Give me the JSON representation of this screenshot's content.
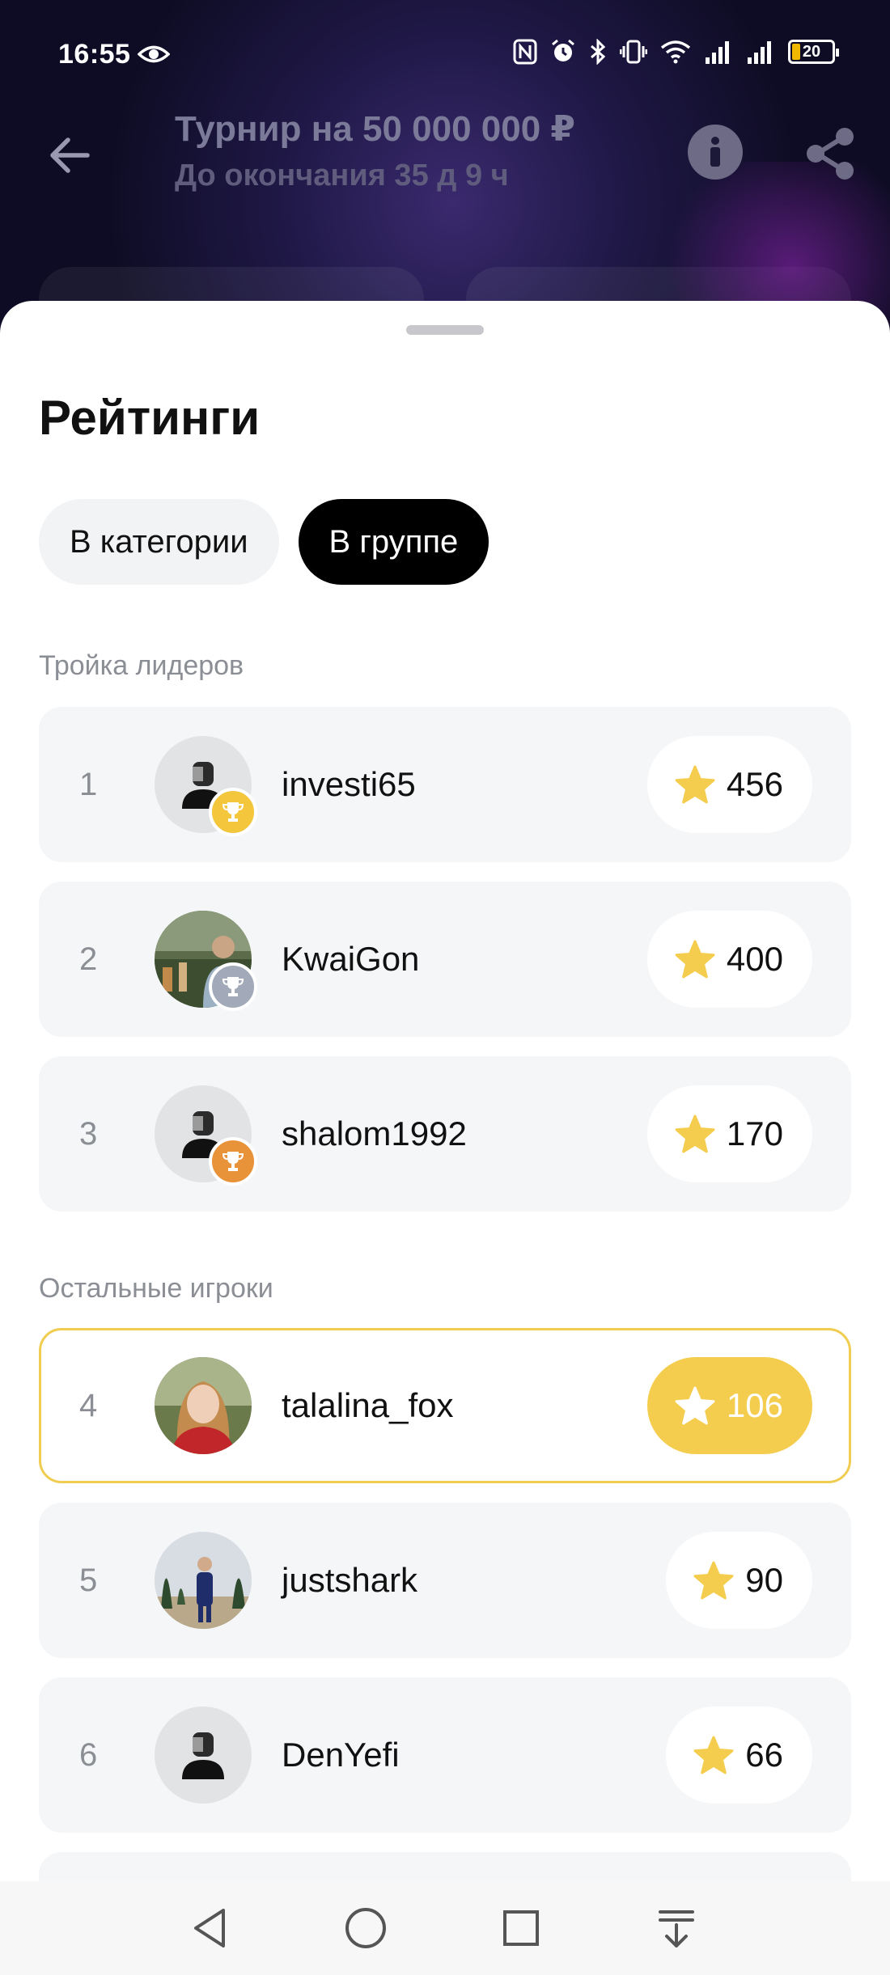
{
  "status_bar": {
    "time": "16:55",
    "battery": "20",
    "icons": [
      "eye-icon",
      "nfc-icon",
      "alarm-icon",
      "bluetooth-icon",
      "vibrate-icon",
      "wifi-icon",
      "signal-icon",
      "signal-icon",
      "battery-icon"
    ]
  },
  "header": {
    "title": "Турнир на 50 000 000 ₽",
    "subtitle": "До окончания 35 д 9 ч",
    "back_icon": "arrow-left-icon",
    "info_icon": "info-icon",
    "share_icon": "share-icon"
  },
  "sheet": {
    "title": "Рейтинги",
    "tabs": [
      {
        "label": "В категории",
        "active": false
      },
      {
        "label": "В группе",
        "active": true
      }
    ],
    "leaders_label": "Тройка лидеров",
    "others_label": "Остальные игроки"
  },
  "leaders": [
    {
      "rank": "1",
      "username": "investi65",
      "score": "456",
      "medal": "gold",
      "avatar": "default"
    },
    {
      "rank": "2",
      "username": "KwaiGon",
      "score": "400",
      "medal": "silver",
      "avatar": "photo"
    },
    {
      "rank": "3",
      "username": "shalom1992",
      "score": "170",
      "medal": "bronze",
      "avatar": "default"
    }
  ],
  "others": [
    {
      "rank": "4",
      "username": "talalina_fox",
      "score": "106",
      "current_user": true,
      "avatar": "photo"
    },
    {
      "rank": "5",
      "username": "justshark",
      "score": "90",
      "avatar": "photo"
    },
    {
      "rank": "6",
      "username": "DenYefi",
      "score": "66",
      "avatar": "default"
    }
  ],
  "colors": {
    "accent_yellow": "#f5cd4e",
    "gold": "#f3c63c",
    "silver": "#a2a9b8",
    "bronze": "#e8923a",
    "row_bg": "#f5f6f7"
  },
  "nav_bar": {
    "buttons": [
      "back-triangle-icon",
      "home-circle-icon",
      "recents-square-icon",
      "notifications-pull-icon"
    ]
  }
}
